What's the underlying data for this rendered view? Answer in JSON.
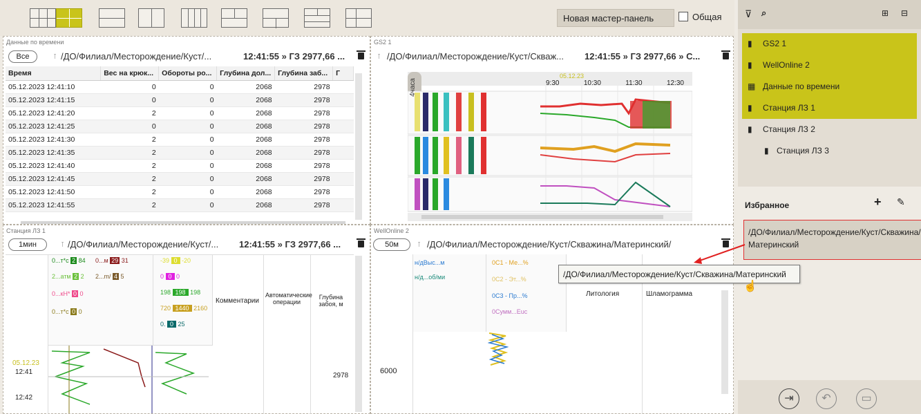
{
  "toolbar": {
    "new_panel_label": "Новая мастер-панель",
    "common_label": "Общая"
  },
  "time_panel": {
    "title": "Данные по времени",
    "all_button": "Все",
    "path": "/ДО/Филиал/Месторождение/Куст/...",
    "time_text": "12:41:55 » ГЗ 2977,66 ...",
    "columns": [
      "Время",
      "Вес на крюк...",
      "Обороты ро...",
      "Глубина дол...",
      "Глубина заб...",
      "Г"
    ],
    "rows": [
      [
        "05.12.2023 12:41:10",
        "0",
        "0",
        "2068",
        "2978"
      ],
      [
        "05.12.2023 12:41:15",
        "0",
        "0",
        "2068",
        "2978"
      ],
      [
        "05.12.2023 12:41:20",
        "2",
        "0",
        "2068",
        "2978"
      ],
      [
        "05.12.2023 12:41:25",
        "0",
        "0",
        "2068",
        "2978"
      ],
      [
        "05.12.2023 12:41:30",
        "2",
        "0",
        "2068",
        "2978"
      ],
      [
        "05.12.2023 12:41:35",
        "2",
        "0",
        "2068",
        "2978"
      ],
      [
        "05.12.2023 12:41:40",
        "2",
        "0",
        "2068",
        "2978"
      ],
      [
        "05.12.2023 12:41:45",
        "2",
        "0",
        "2068",
        "2978"
      ],
      [
        "05.12.2023 12:41:50",
        "2",
        "0",
        "2068",
        "2978"
      ],
      [
        "05.12.2023 12:41:55",
        "2",
        "0",
        "2068",
        "2978"
      ]
    ]
  },
  "gs2_panel": {
    "title": "GS2 1",
    "path": "/ДО/Филиал/Месторождение/Куст/Скваж...",
    "time_text": "12:41:55 » ГЗ 2977,66 » С...",
    "range_label": "4часа",
    "ticks": [
      "9:30",
      "10:30",
      "11:30",
      "12:30"
    ],
    "cursor_time": "05.12.23"
  },
  "lz_panel": {
    "title": "Станция ЛЗ 1",
    "interval_button": "1мин",
    "path": "/ДО/Филиал/Месторождение/Куст/...",
    "time_text": "12:41:55 » ГЗ 2977,66 ...",
    "gauges": [
      {
        "label": "0...т*с",
        "v1": "2",
        "v2": "84",
        "color": "#1a8a1a"
      },
      {
        "label": "0...м",
        "v1": "29",
        "v2": "31",
        "color": "#8a1a1a"
      },
      {
        "label": "2...атм",
        "v1": "2",
        "v2": "2",
        "color": "#6ac03a"
      },
      {
        "label": "2...m/",
        "v1": "4",
        "v2": "5",
        "color": "#7a5a2a"
      },
      {
        "label": "0...кН*",
        "v1": "0",
        "v2": "0",
        "color": "#ee4a8a"
      },
      {
        "label": "0...т*с",
        "v1": "0",
        "v2": "0",
        "color": "#8a7a1a"
      }
    ],
    "right_gauges": [
      {
        "left": "-39",
        "val": "0",
        "right": "-20",
        "color": "#dddd30"
      },
      {
        "left": "0",
        "val": "0",
        "right": "0",
        "color": "#e020e0"
      },
      {
        "left": "198",
        "val": "198",
        "right": "198",
        "color": "#2aa82a"
      },
      {
        "left": "720",
        "val": "1440",
        "right": "2160",
        "color": "#c8a020"
      },
      {
        "left": "0.",
        "val": "0",
        "right": "25",
        "color": "#0a6a6a"
      }
    ],
    "col_comments": "Комментарии",
    "col_auto": "Автоматические операции",
    "col_depth": "Глубина забоя, м",
    "date": "05.12.23",
    "time1": "12:41",
    "time2": "12:42",
    "depth_value": "2978"
  },
  "well_panel": {
    "title": "WellOnline 2",
    "interval_button": "50м",
    "path": "/ДО/Филиал/Месторождение/Куст/Скважина/Материнский/",
    "left_tracks": [
      "н/дВыс...м",
      "н/д...об/ми"
    ],
    "right_tracks": [
      "0С1 - Ме...%",
      "0С2 - Эт...%",
      "0С3 - Пр...%",
      "0Сумм...Еuc"
    ],
    "lithology": "Литология",
    "sludge": "Шламограмма",
    "depth": "6000"
  },
  "sidebar": {
    "items": [
      {
        "label": "GS2 1",
        "hl": true
      },
      {
        "label": "WellOnline 2",
        "hl": true
      },
      {
        "label": "Данные по времени",
        "hl": true
      },
      {
        "label": "Станция ЛЗ 1",
        "hl": true
      },
      {
        "label": "Станция ЛЗ 2",
        "hl": false
      },
      {
        "label": "Станция ЛЗ 3",
        "hl": false
      }
    ],
    "favorites_title": "Избранное",
    "favorite_path": "/ДО/Филиал/Месторождение/Куст/Скважина/Материнский",
    "tooltip": "/ДО/Филиал/Месторождение/Куст/Скважина/Материнский"
  }
}
